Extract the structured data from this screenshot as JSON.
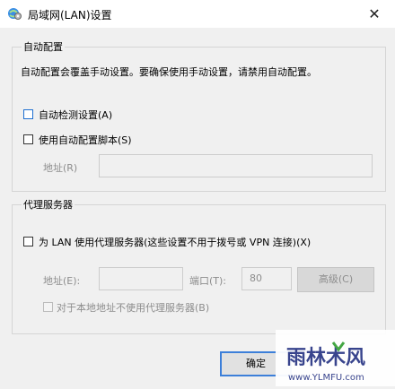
{
  "window": {
    "title": "局域网(LAN)设置"
  },
  "auto_config": {
    "group_label": "自动配置",
    "description": "自动配置会覆盖手动设置。要确保使用手动设置，请禁用自动配置。",
    "detect_label": "自动检测设置(A)",
    "detect_checked": false,
    "script_label": "使用自动配置脚本(S)",
    "script_checked": false,
    "address_label": "地址(R)",
    "address_value": ""
  },
  "proxy": {
    "group_label": "代理服务器",
    "use_proxy_label": "为 LAN 使用代理服务器(这些设置不用于拨号或 VPN 连接)(X)",
    "use_proxy_checked": false,
    "address_label": "地址(E):",
    "address_value": "",
    "port_label": "端口(T):",
    "port_value": "80",
    "advanced_label": "高级(C)",
    "bypass_label": "对于本地地址不使用代理服务器(B)",
    "bypass_checked": false
  },
  "buttons": {
    "ok_label": "确定"
  },
  "watermark": {
    "name": "雨林木风",
    "url": "www.YLMFU.com"
  }
}
